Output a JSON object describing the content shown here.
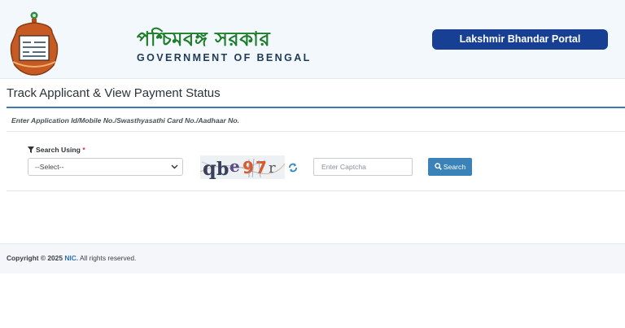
{
  "header": {
    "title_bengali": "পশ্চিমবঙ্গ সরকার",
    "title_english": "GOVERNMENT OF BENGAL",
    "portal_button": "Lakshmir Bhandar Portal"
  },
  "page": {
    "title": "Track Applicant & View Payment Status",
    "instruction": "Enter Application Id/Mobile No./Swasthyasathi Card No./Aadhaar No."
  },
  "form": {
    "search_using_label": "Search Using",
    "required_mark": "*",
    "select_value": "--Select--",
    "captcha_text": "qbe97r",
    "captcha_placeholder": "Enter Captcha",
    "search_button": "Search"
  },
  "footer": {
    "copyright_prefix": "Copyright © 2025",
    "org": "NIC.",
    "rights": "All rights reserved."
  },
  "colors": {
    "brand_green": "#1e7d2b",
    "portal_blue": "#173f93",
    "accent_blue": "#3a82b8",
    "required_red": "#d0312d"
  }
}
